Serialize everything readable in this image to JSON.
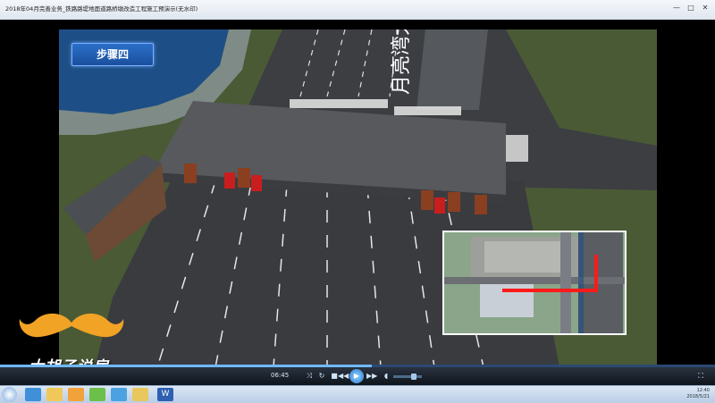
{
  "window": {
    "title": "2018年04月完善业务_铁路路堤地面道路桥墩改造工程施工预演示(无水印)",
    "minimize": "—",
    "maximize": "□",
    "close": "✕"
  },
  "scene": {
    "step_label": "步骤四",
    "road_sign": "月亮湾大道"
  },
  "player": {
    "time": "06:45",
    "icons": [
      "shuffle-icon",
      "repeat-icon",
      "stop-icon",
      "previous-icon",
      "play-icon",
      "next-icon",
      "volume-icon"
    ],
    "progress": 0.52,
    "volume": 0.75
  },
  "watermark": {
    "text": "大胡子说房"
  },
  "taskbar": {
    "items": [
      "start-orb",
      "ie-icon",
      "folder-icon",
      "media-player-icon",
      "chrome-icon",
      "ie2-icon",
      "folder2-icon",
      "word-icon"
    ],
    "clock_time": "12:40",
    "clock_date": "2018/5/21"
  },
  "colors": {
    "accent": "#2a6fc8",
    "route": "#ff1a1a"
  }
}
